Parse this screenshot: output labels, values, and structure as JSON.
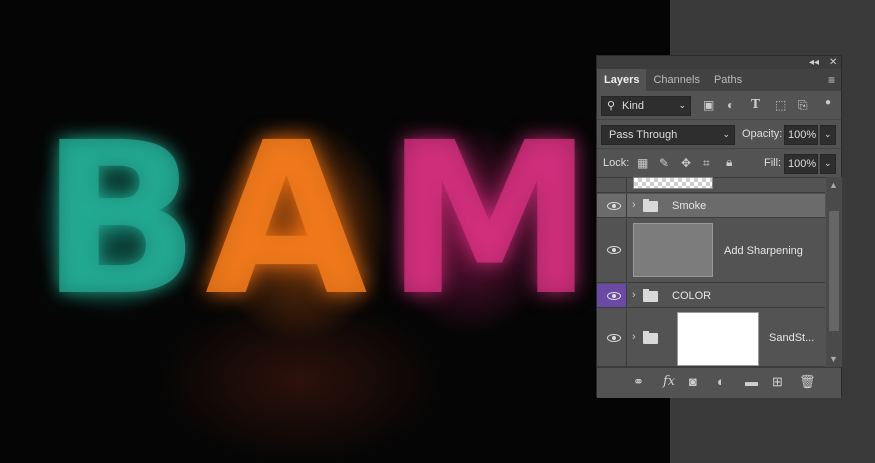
{
  "artwork": {
    "letters": [
      "B",
      "A",
      "M"
    ],
    "colors": [
      "#23a893",
      "#f07a1c",
      "#d6307f"
    ]
  },
  "panel": {
    "collapse_glyph": "◂◂",
    "close_glyph": "✕",
    "tabs": [
      {
        "label": "Layers",
        "active": true
      },
      {
        "label": "Channels",
        "active": false
      },
      {
        "label": "Paths",
        "active": false
      }
    ],
    "menu_icon": "hamburger-menu-icon",
    "filter": {
      "value": "Kind",
      "icons": [
        "image-filter-icon",
        "adjustment-filter-icon",
        "type-filter-icon",
        "shape-filter-icon",
        "smart-object-filter-icon",
        "filter-toggle-icon"
      ]
    },
    "blend_mode": "Pass Through",
    "opacity_label": "Opacity:",
    "opacity_value": "100%",
    "lock_label": "Lock:",
    "lock_icons": [
      "lock-transparent-pixels-icon",
      "lock-image-pixels-icon",
      "lock-position-icon",
      "lock-artboard-icon",
      "lock-all-icon"
    ],
    "fill_label": "Fill:",
    "fill_value": "100%",
    "layers": [
      {
        "name": "",
        "type": "thumbnail-partial"
      },
      {
        "name": "Smoke",
        "type": "group",
        "selected": true
      },
      {
        "name": "Add Sharpening",
        "type": "layer"
      },
      {
        "name": "COLOR",
        "type": "group",
        "eye_highlight": "#6a4aa5"
      },
      {
        "name": "SandSt...",
        "type": "group-with-mask"
      }
    ],
    "footer_icons": [
      "link-layers-icon",
      "fx-icon",
      "add-mask-icon",
      "adjustment-layer-icon",
      "new-group-icon",
      "new-layer-icon",
      "delete-icon"
    ]
  }
}
